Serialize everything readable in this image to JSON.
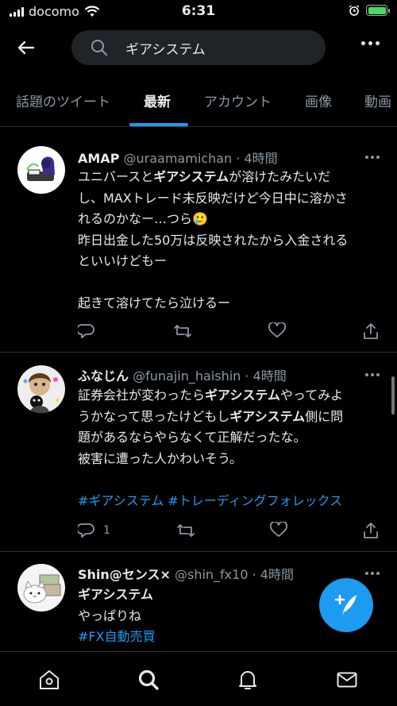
{
  "status_bar": {
    "carrier": "docomo",
    "time": "6:31"
  },
  "search": {
    "query": "ギアシステム"
  },
  "tabs": [
    {
      "label": "話題のツイート"
    },
    {
      "label": "最新"
    },
    {
      "label": "アカウント"
    },
    {
      "label": "画像"
    },
    {
      "label": "動画"
    }
  ],
  "tweets": [
    {
      "name": "AMAP",
      "handle": "@uraamamichan",
      "time": "4時間",
      "lines": [
        [
          "ユニバースと",
          "ギアシステム",
          "が溶けたみたいだ"
        ],
        [
          "し、MAXトレード未反映だけど今日中に溶かさ"
        ],
        [
          "れるのかなー…つら🥲"
        ],
        [
          "昨日出金した50万は反映されたから入金される"
        ],
        [
          "といいけどもー"
        ],
        [
          "起きて溶けてたら泣けるー"
        ]
      ],
      "reply_count": ""
    },
    {
      "name": "ふなじん",
      "handle": "@funajin_haishin",
      "time": "4時間",
      "lines": [
        [
          "証券会社が変わったら",
          "ギアシステム",
          "やってみよ"
        ],
        [
          "うかなって思ったけどもし",
          "ギアシステム",
          "側に問"
        ],
        [
          "題があるならやらなくて正解だったな。"
        ],
        [
          "被害に遭った人かわいそう。"
        ]
      ],
      "hashtags": "#ギアシステム #トレーディングフォレックス",
      "reply_count": "1"
    },
    {
      "name": "Shin@センス×",
      "handle": "@shin_fx10",
      "time": "4時間",
      "line1": "ギアシステム",
      "line2": "やっぱりね",
      "hashtag": "#FX自動売買"
    }
  ],
  "icons": {
    "back": "back-arrow-icon",
    "search": "search-icon",
    "more": "more-icon",
    "reply": "reply-icon",
    "retweet": "retweet-icon",
    "like": "like-icon",
    "share": "share-icon",
    "compose": "compose-icon",
    "home": "home-icon",
    "explore": "search-icon",
    "notifications": "bell-icon",
    "messages": "mail-icon"
  },
  "colors": {
    "accent": "#1d9bf0",
    "background": "#000000",
    "muted": "#8b98a5"
  }
}
